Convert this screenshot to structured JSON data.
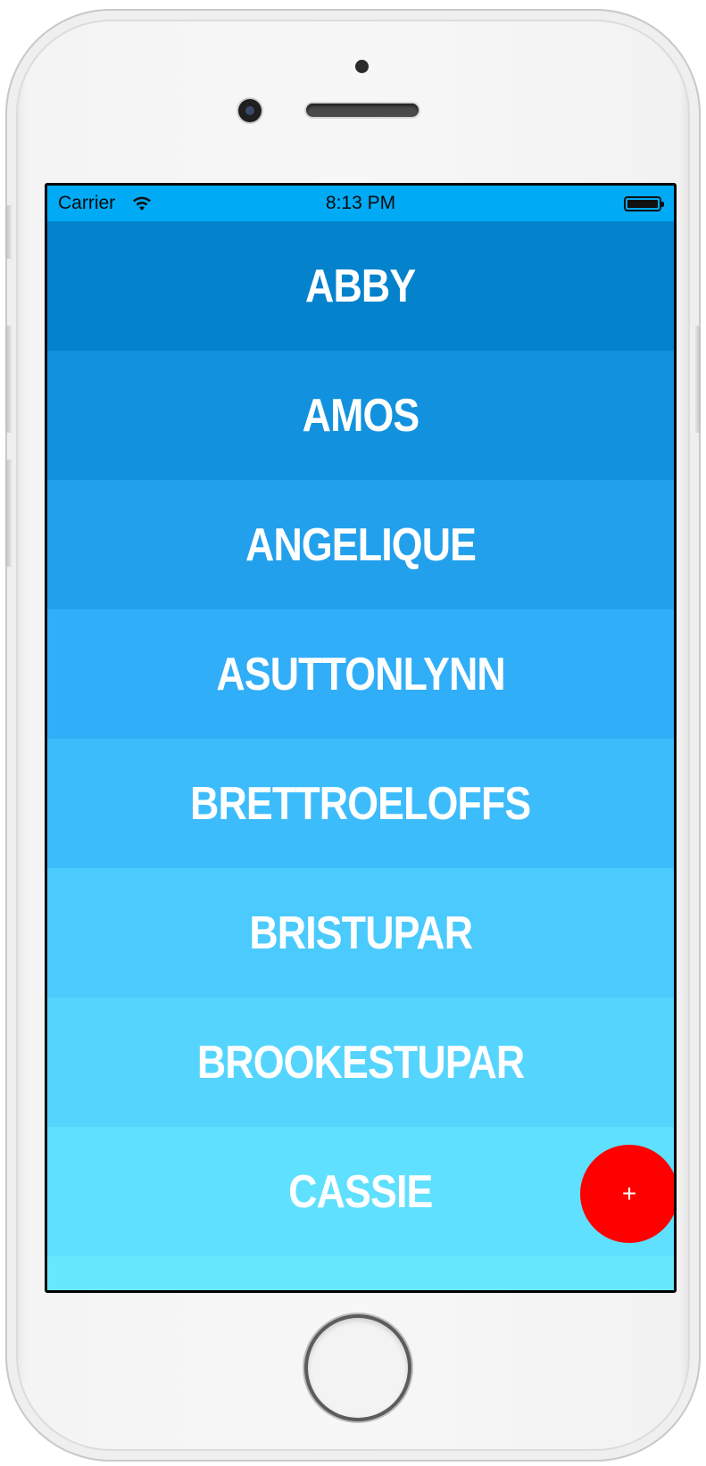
{
  "status_bar": {
    "carrier": "Carrier",
    "time": "8:13 PM",
    "background": "#00aaf5"
  },
  "list": {
    "items": [
      {
        "label": "ABBY",
        "color": "#0582cc"
      },
      {
        "label": "AMOS",
        "color": "#1292de"
      },
      {
        "label": "ANGELIQUE",
        "color": "#22a0ec"
      },
      {
        "label": "ASUTTONLYNN",
        "color": "#30aef8"
      },
      {
        "label": "BRETTROELOFFS",
        "color": "#3dbcfc"
      },
      {
        "label": "BRISTUPAR",
        "color": "#4acafd"
      },
      {
        "label": "BROOKESTUPAR",
        "color": "#55d5fe"
      },
      {
        "label": "CASSIE",
        "color": "#5fe0fe"
      },
      {
        "label": "",
        "color": "#68e8ff"
      }
    ]
  },
  "fab": {
    "label": "+",
    "color": "#ff0000"
  },
  "icons": [
    "wifi-icon",
    "battery-icon",
    "home-button"
  ]
}
